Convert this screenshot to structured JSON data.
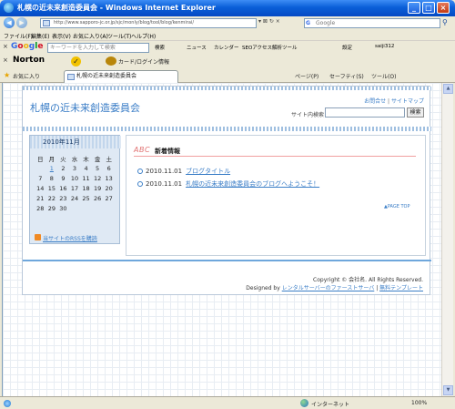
{
  "window": {
    "title": "札幌の近未来創造委員会 - Windows Internet Explorer",
    "minimize": "_",
    "maximize": "□",
    "close": "×"
  },
  "address_bar": {
    "url": "http://www.sapporo-jc.or.jp/sjc/monly/blog/tool/blog/kenmirai/",
    "tools": "▾ ⊠ ↻ ×",
    "search_placeholder": "Google"
  },
  "menu": [
    "ファイル(F)",
    "編集(E)",
    "表示(V)",
    "お気に入り(A)",
    "ツール(T)",
    "ヘルプ(H)"
  ],
  "google_toolbar": {
    "close": "×",
    "logo": "Google",
    "keyword_placeholder": "キーワードを入力して検索",
    "search_button": "検索",
    "items": [
      "ニュース",
      "カレンダー",
      "SEOアクセス解析ツール",
      "設定",
      "saiji312"
    ]
  },
  "norton_toolbar": {
    "close": "×",
    "logo": "Norton",
    "check": "✓",
    "card_label": "カード/ログイン情報"
  },
  "command_bar": {
    "favorites_label": "お気に入り",
    "tab_title": "札幌の近未来創造委員会",
    "commands": [
      "ページ(P)",
      "セーフティ(S)",
      "ツール(O)"
    ]
  },
  "site": {
    "title": "札幌の近未来創造委員会",
    "links": [
      "お問合せ",
      "サイトマップ"
    ],
    "link_separator": "|",
    "search_label": "サイト内検索",
    "search_button": "検索",
    "calendar": {
      "caption": "2010年11月",
      "weekdays": [
        "日",
        "月",
        "火",
        "水",
        "木",
        "金",
        "土"
      ],
      "weeks": [
        [
          "",
          "1",
          "2",
          "3",
          "4",
          "5",
          "6"
        ],
        [
          "7",
          "8",
          "9",
          "10",
          "11",
          "12",
          "13"
        ],
        [
          "14",
          "15",
          "16",
          "17",
          "18",
          "19",
          "20"
        ],
        [
          "21",
          "22",
          "23",
          "24",
          "25",
          "26",
          "27"
        ],
        [
          "28",
          "29",
          "30",
          "",
          "",
          "",
          ""
        ]
      ],
      "linked_day": "1"
    },
    "rss_link": "当サイトのRSSを購読",
    "news": {
      "abc": "ABC",
      "title": "新着情報",
      "items": [
        {
          "date": "2010.11.01",
          "text": "ブログタイトル"
        },
        {
          "date": "2010.11.01",
          "text": "札幌の近未来創造委員会のブログへようこそ！"
        }
      ]
    },
    "page_top": "▲PAGE TOP",
    "copyright": "Copyright © 会社名. All Rights Reserved.",
    "designed_by": "Designed by",
    "designed_link1": "レンタルサーバーのファーストサーバ",
    "designed_sep": "|",
    "designed_link2": "無料テンプレート"
  },
  "status_bar": {
    "zone": "インターネット",
    "zoom": "100%"
  }
}
